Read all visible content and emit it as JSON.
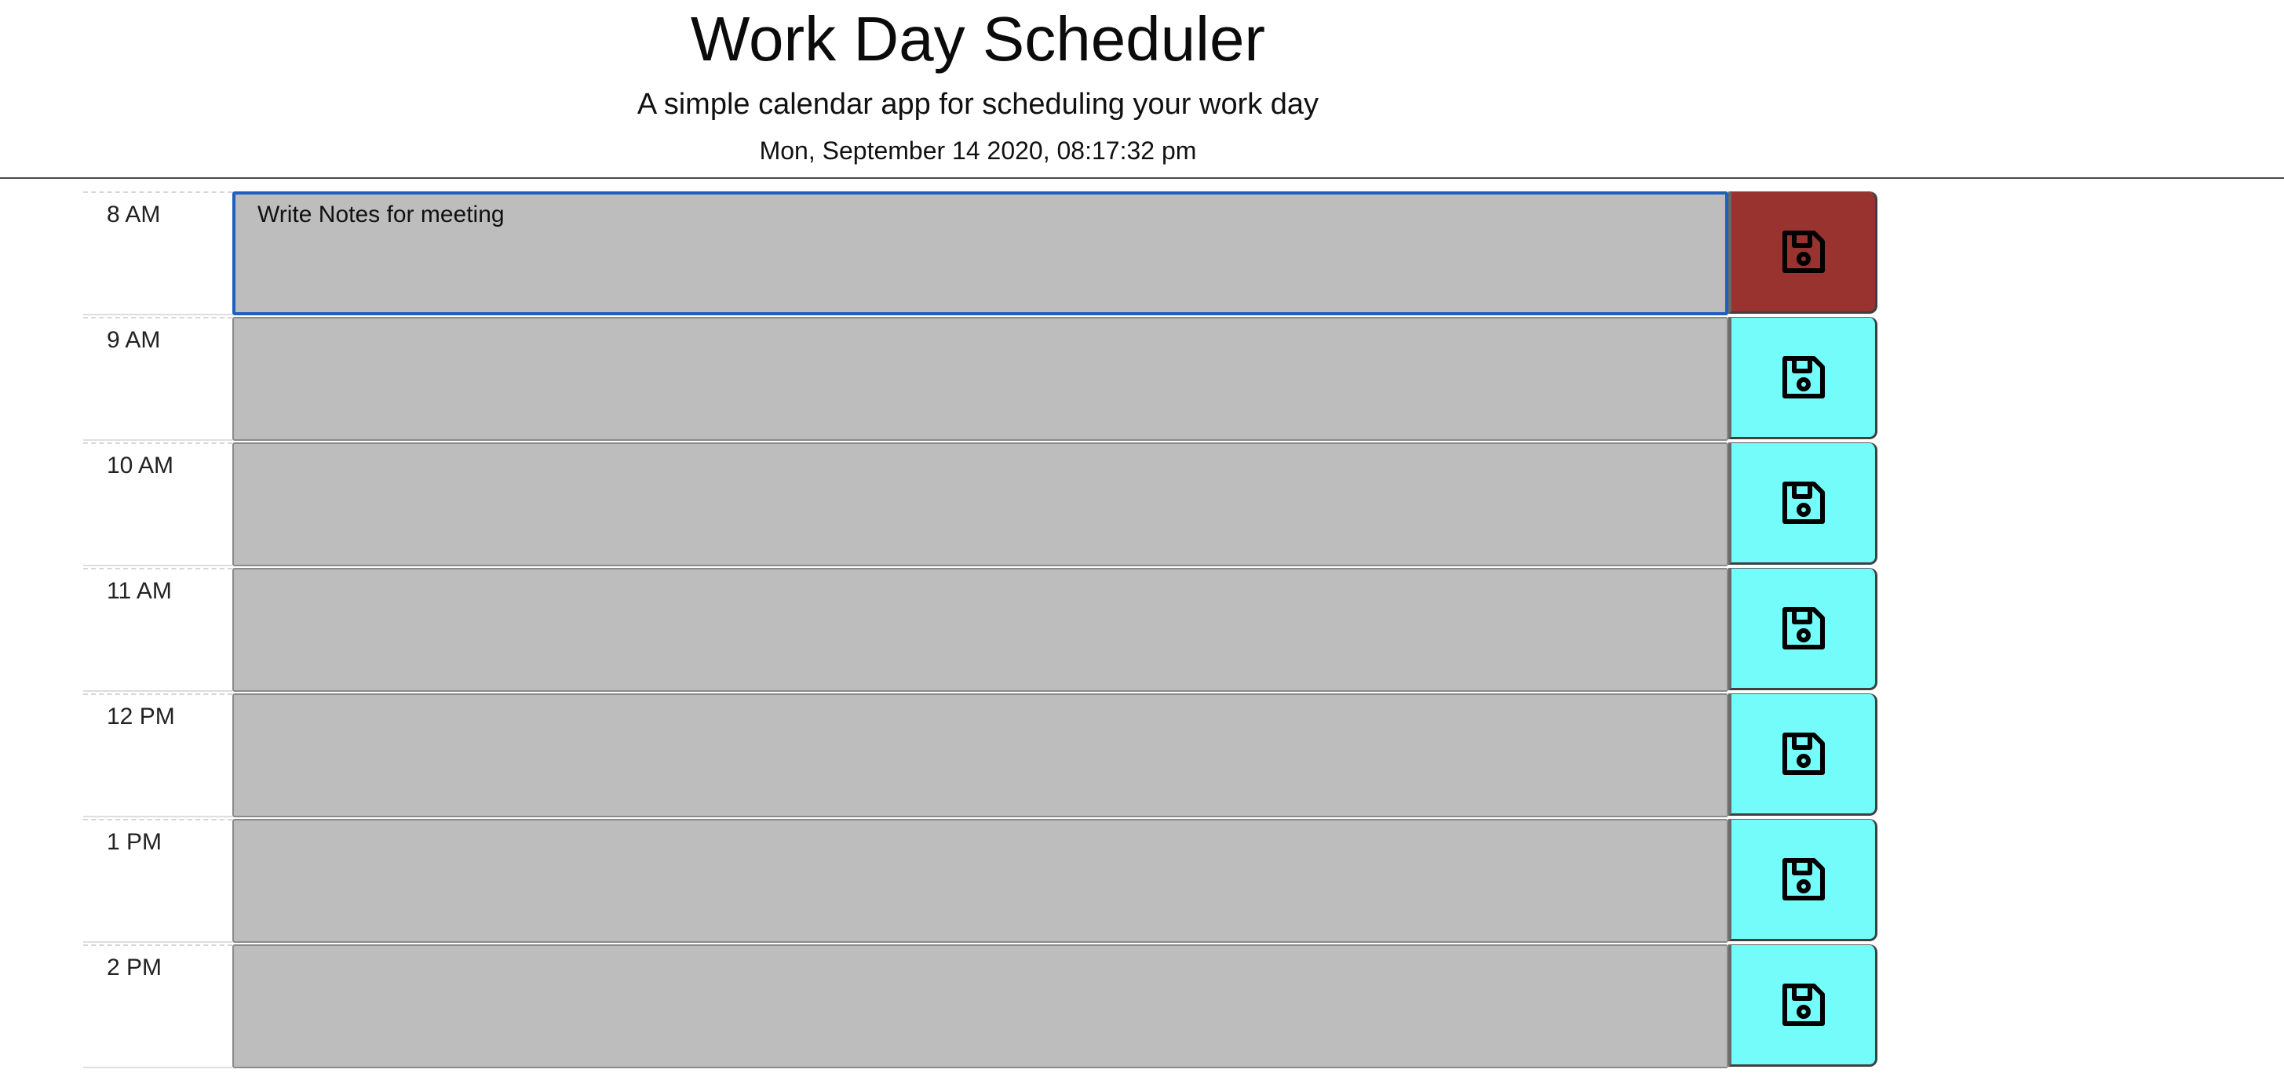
{
  "header": {
    "title": "Work Day Scheduler",
    "subtitle": "A simple calendar app for scheduling your work day",
    "current_day": "Mon, September 14 2020, 08:17:32 pm"
  },
  "colors": {
    "past_button": "#993330",
    "future_button": "#74fcfb",
    "textarea_bg": "#bdbdbd",
    "focus_outline": "#1f5fbf"
  },
  "icons": {
    "save": "floppy-disk-save-icon"
  },
  "schedule": {
    "rows": [
      {
        "hour": "8 AM",
        "description": "Write Notes for meeting",
        "status": "past"
      },
      {
        "hour": "9 AM",
        "description": "",
        "status": "future"
      },
      {
        "hour": "10 AM",
        "description": "",
        "status": "future"
      },
      {
        "hour": "11 AM",
        "description": "",
        "status": "future"
      },
      {
        "hour": "12 PM",
        "description": "",
        "status": "future"
      },
      {
        "hour": "1 PM",
        "description": "",
        "status": "future"
      },
      {
        "hour": "2 PM",
        "description": "",
        "status": "future"
      }
    ]
  }
}
